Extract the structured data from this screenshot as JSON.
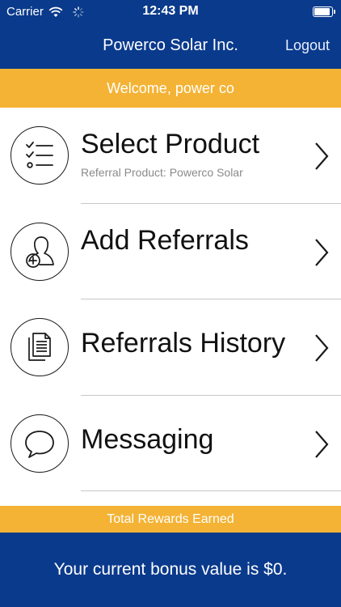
{
  "status": {
    "carrier": "Carrier",
    "time": "12:43 PM"
  },
  "nav": {
    "title": "Powerco Solar Inc.",
    "logout_label": "Logout"
  },
  "welcome": "Welcome, power co",
  "menu": [
    {
      "title": "Select Product",
      "subtitle": "Referral Product: Powerco Solar",
      "icon": "checklist-icon"
    },
    {
      "title": "Add Referrals",
      "subtitle": "",
      "icon": "add-person-icon"
    },
    {
      "title": "Referrals History",
      "subtitle": "",
      "icon": "documents-icon"
    },
    {
      "title": "Messaging",
      "subtitle": "",
      "icon": "chat-bubble-icon"
    }
  ],
  "rewards": {
    "header": "Total Rewards Earned",
    "bonus_text": "Your current bonus value is $0."
  },
  "colors": {
    "primary_blue": "#0a3a8c",
    "accent_yellow": "#f4b335"
  }
}
